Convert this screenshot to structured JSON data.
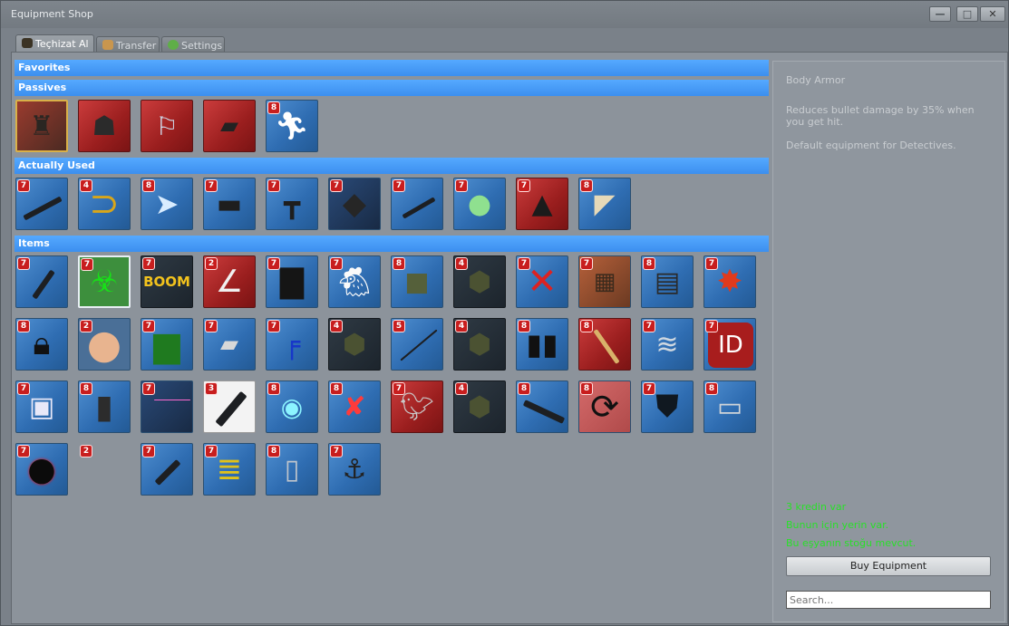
{
  "window": {
    "title": "Equipment Shop",
    "minimize": "—",
    "maximize": "□",
    "close": "✕"
  },
  "tabs": [
    {
      "label": "Teçhizat Al",
      "icon": "bag-icon",
      "active": true
    },
    {
      "label": "Transfer",
      "icon": "transfer-icon",
      "active": false
    },
    {
      "label": "Settings",
      "icon": "gear-icon",
      "active": false
    }
  ],
  "categories": {
    "favorites": "Favorites",
    "passives": "Passives",
    "actually_used": "Actually Used",
    "items": "Items"
  },
  "passives": [
    {
      "badge": "",
      "icon": "body-armor-icon"
    },
    {
      "badge": "",
      "icon": "disguise-icon"
    },
    {
      "badge": "",
      "icon": "armor-boots-icon"
    },
    {
      "badge": "",
      "icon": "radar-icon"
    },
    {
      "badge": "8",
      "icon": "running-man-icon"
    }
  ],
  "actually_used": [
    {
      "badge": "7",
      "icon": "rifle-icon"
    },
    {
      "badge": "4",
      "icon": "banana-boomerang-icon"
    },
    {
      "badge": "8",
      "icon": "speed-arrow-icon"
    },
    {
      "badge": "7",
      "icon": "bomb-station-icon"
    },
    {
      "badge": "7",
      "icon": "uzi-icon"
    },
    {
      "badge": "7",
      "icon": "armor-plate-icon"
    },
    {
      "badge": "7",
      "icon": "knife-icon"
    },
    {
      "badge": "7",
      "icon": "turtle-icon"
    },
    {
      "badge": "7",
      "icon": "mine-icon"
    },
    {
      "badge": "8",
      "icon": "paper-icon"
    }
  ],
  "items": [
    {
      "badge": "7",
      "icon": "silenced-pistol-icon"
    },
    {
      "badge": "7",
      "icon": "biohazard-icon"
    },
    {
      "badge": "7",
      "icon": "boom-icon"
    },
    {
      "badge": "2",
      "icon": "boomerang-icon"
    },
    {
      "badge": "7",
      "icon": "briefcase-icon"
    },
    {
      "badge": "7",
      "icon": "chicken-icon"
    },
    {
      "badge": "8",
      "icon": "vest-icon"
    },
    {
      "badge": "4",
      "icon": "grenade-pack-icon"
    },
    {
      "badge": "7",
      "icon": "no-decoy-icon"
    },
    {
      "badge": "7",
      "icon": "explosion-scene-icon"
    },
    {
      "badge": "8",
      "icon": "radio-box-icon"
    },
    {
      "badge": "7",
      "icon": "exploding-device-icon"
    },
    {
      "badge": "8",
      "icon": "padlock-icon"
    },
    {
      "badge": "2",
      "icon": "face-icon"
    },
    {
      "badge": "7",
      "icon": "crate-icon"
    },
    {
      "badge": "7",
      "icon": "canister-icon"
    },
    {
      "badge": "7",
      "icon": "blue-pistol-icon"
    },
    {
      "badge": "4",
      "icon": "grenade-pack-icon"
    },
    {
      "badge": "5",
      "icon": "spear-icon"
    },
    {
      "badge": "4",
      "icon": "grenade-pack-icon"
    },
    {
      "badge": "8",
      "icon": "binocular-icon"
    },
    {
      "badge": "8",
      "icon": "bat-icon"
    },
    {
      "badge": "7",
      "icon": "spring-icon"
    },
    {
      "badge": "7",
      "icon": "id-icon"
    },
    {
      "badge": "7",
      "icon": "health-station-icon"
    },
    {
      "badge": "8",
      "icon": "barrel-icon"
    },
    {
      "badge": "7",
      "icon": "laser-icon"
    },
    {
      "badge": "3",
      "icon": "minigun-icon"
    },
    {
      "badge": "8",
      "icon": "portal-gun-icon"
    },
    {
      "badge": "8",
      "icon": "swap-gun-icon"
    },
    {
      "badge": "7",
      "icon": "pigeon-icon"
    },
    {
      "badge": "4",
      "icon": "grenade-pack-icon"
    },
    {
      "badge": "8",
      "icon": "assault-rifle-icon"
    },
    {
      "badge": "8",
      "icon": "recycle-icon"
    },
    {
      "badge": "7",
      "icon": "robot-mask-icon"
    },
    {
      "badge": "8",
      "icon": "scanner-icon"
    },
    {
      "badge": "7",
      "icon": "bomb-icon"
    },
    {
      "badge": "2",
      "icon": "empty-slot-icon"
    },
    {
      "badge": "7",
      "icon": "pistol-icon"
    },
    {
      "badge": "7",
      "icon": "coil-icon"
    },
    {
      "badge": "8",
      "icon": "phone-icon"
    },
    {
      "badge": "7",
      "icon": "hook-icon"
    }
  ],
  "info": {
    "name": "Body Armor",
    "description": "Reduces bullet damage by 35% when you get hit.",
    "default_note": "Default equipment for Detectives.",
    "credits": "3 kredin var",
    "room": "Bunun için yerin var.",
    "stock": "Bu eşyanın stoğu mevcut.",
    "buy_label": "Buy Equipment",
    "search_placeholder": "Search..."
  },
  "colors": {
    "category_header": "#4aa0ff",
    "status_green": "#29e029",
    "badge_red": "#c81e1e"
  }
}
